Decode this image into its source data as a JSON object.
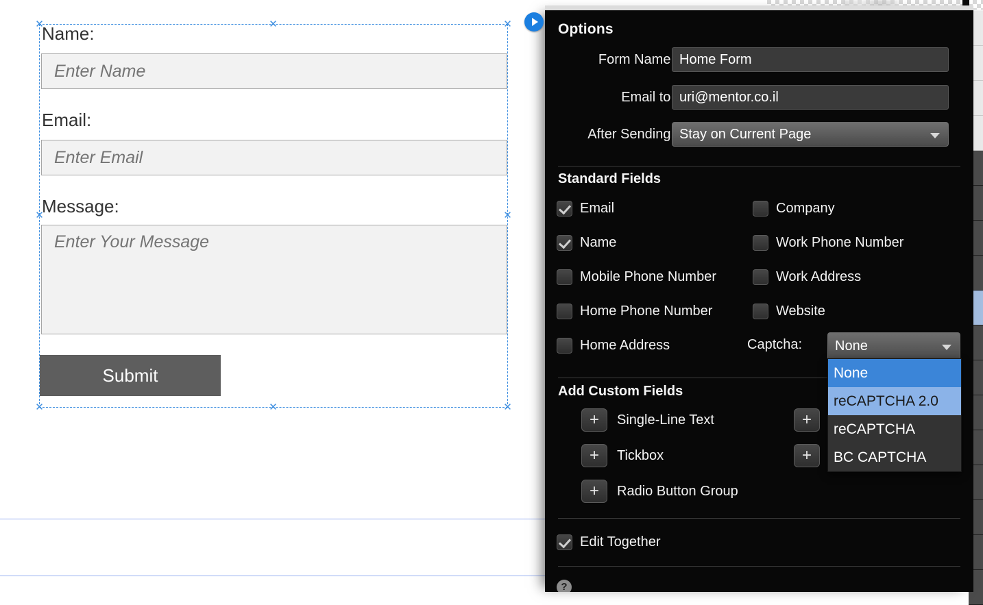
{
  "canvas": {
    "form": {
      "fields": [
        {
          "label": "Name:",
          "placeholder": "Enter Name"
        },
        {
          "label": "Email:",
          "placeholder": "Enter Email"
        },
        {
          "label": "Message:",
          "placeholder": "Enter Your Message"
        }
      ],
      "submit_label": "Submit"
    },
    "play_button": "play-icon",
    "selection_color": "#3d8ee0",
    "guide_color": "#97aef0"
  },
  "options_panel": {
    "title": "Options",
    "fields": {
      "form_name_label": "Form Name:",
      "form_name_value": "Home Form",
      "email_to_label": "Email to:",
      "email_to_value": "uri@mentor.co.il",
      "after_sending_label": "After Sending:",
      "after_sending_value": "Stay on Current Page"
    },
    "standard_fields": {
      "title": "Standard Fields",
      "left_column": [
        {
          "label": "Email",
          "checked": true
        },
        {
          "label": "Name",
          "checked": true
        },
        {
          "label": "Mobile Phone Number",
          "checked": false
        },
        {
          "label": "Home Phone Number",
          "checked": false
        },
        {
          "label": "Home Address",
          "checked": false
        }
      ],
      "right_column": [
        {
          "label": "Company",
          "checked": false
        },
        {
          "label": "Work Phone Number",
          "checked": false
        },
        {
          "label": "Work Address",
          "checked": false
        },
        {
          "label": "Website",
          "checked": false
        }
      ]
    },
    "captcha": {
      "label": "Captcha:",
      "value": "None",
      "options": [
        {
          "label": "None",
          "state": "selected"
        },
        {
          "label": "reCAPTCHA 2.0",
          "state": "hover"
        },
        {
          "label": "reCAPTCHA",
          "state": "normal"
        },
        {
          "label": "BC CAPTCHA",
          "state": "normal"
        }
      ]
    },
    "add_custom_fields": {
      "title": "Add Custom Fields",
      "left_column": [
        {
          "button": "+",
          "label": "Single-Line Text"
        },
        {
          "button": "+",
          "label": "Tickbox"
        },
        {
          "button": "+",
          "label": "Radio Button Group"
        }
      ],
      "right_column": [
        {
          "button": "+",
          "label": ""
        },
        {
          "button": "+",
          "label": ""
        }
      ]
    },
    "edit_together": {
      "label": "Edit Together",
      "checked": true
    },
    "help_icon": "?",
    "accent_color": "#3b85d8",
    "hover_color": "#8bb3e8",
    "panel_bg": "#080808"
  }
}
